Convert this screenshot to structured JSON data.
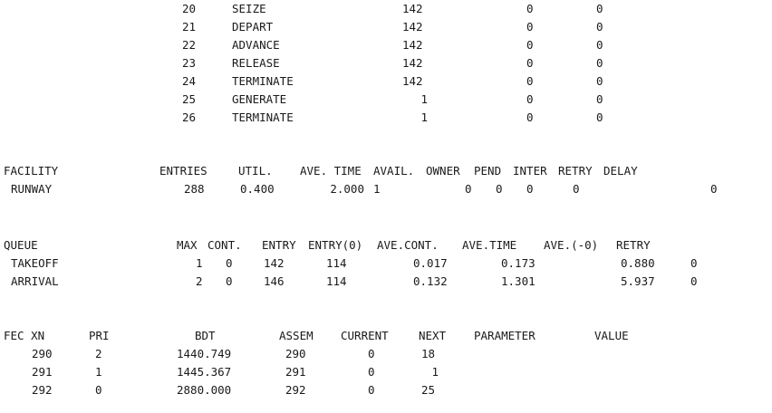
{
  "blocks": [
    {
      "num": "20",
      "name": "SEIZE",
      "entry": "142",
      "current": "0",
      "retry": "0"
    },
    {
      "num": "21",
      "name": "DEPART",
      "entry": "142",
      "current": "0",
      "retry": "0"
    },
    {
      "num": "22",
      "name": "ADVANCE",
      "entry": "142",
      "current": "0",
      "retry": "0"
    },
    {
      "num": "23",
      "name": "RELEASE",
      "entry": "142",
      "current": "0",
      "retry": "0"
    },
    {
      "num": "24",
      "name": "TERMINATE",
      "entry": "142",
      "current": "0",
      "retry": "0"
    },
    {
      "num": "25",
      "name": "GENERATE",
      "entry": "1",
      "current": "0",
      "retry": "0"
    },
    {
      "num": "26",
      "name": "TERMINATE",
      "entry": "1",
      "current": "0",
      "retry": "0"
    }
  ],
  "facility": {
    "headers": {
      "facility": "FACILITY",
      "entries": "ENTRIES",
      "util": "UTIL.",
      "ave_time": "AVE. TIME",
      "avail": "AVAIL.",
      "owner": "OWNER",
      "pend": "PEND",
      "inter": "INTER",
      "retry": "RETRY",
      "delay": "DELAY"
    },
    "rows": [
      {
        "name": "RUNWAY",
        "entries": "288",
        "util": "0.400",
        "ave_time": "2.000",
        "avail": "1",
        "owner": "0",
        "pend": "0",
        "inter": "0",
        "retry": "0",
        "delay": "0"
      }
    ]
  },
  "queue": {
    "headers": {
      "queue": "QUEUE",
      "max": "MAX",
      "cont": "CONT.",
      "entry": "ENTRY",
      "entry0": "ENTRY(0)",
      "ave_cont": "AVE.CONT.",
      "ave_time": "AVE.TIME",
      "ave_0": "AVE.(-0)",
      "retry": "RETRY"
    },
    "rows": [
      {
        "name": "TAKEOFF",
        "max": "1",
        "cont": "0",
        "entry": "142",
        "entry0": "114",
        "ave_cont": "0.017",
        "ave_time": "0.173",
        "ave_0": "0.880",
        "retry": "0"
      },
      {
        "name": "ARRIVAL",
        "max": "2",
        "cont": "0",
        "entry": "146",
        "entry0": "114",
        "ave_cont": "0.132",
        "ave_time": "1.301",
        "ave_0": "5.937",
        "retry": "0"
      }
    ]
  },
  "fec": {
    "headers": {
      "xn": "FEC XN",
      "pri": "PRI",
      "bdt": "BDT",
      "assem": "ASSEM",
      "current": "CURRENT",
      "next": "NEXT",
      "parameter": "PARAMETER",
      "value": "VALUE"
    },
    "rows": [
      {
        "xn": "290",
        "pri": "2",
        "bdt": "1440.749",
        "assem": "290",
        "current": "0",
        "next": "18"
      },
      {
        "xn": "291",
        "pri": "1",
        "bdt": "1445.367",
        "assem": "291",
        "current": "0",
        "next": "1"
      },
      {
        "xn": "292",
        "pri": "0",
        "bdt": "2880.000",
        "assem": "292",
        "current": "0",
        "next": "25"
      }
    ]
  }
}
